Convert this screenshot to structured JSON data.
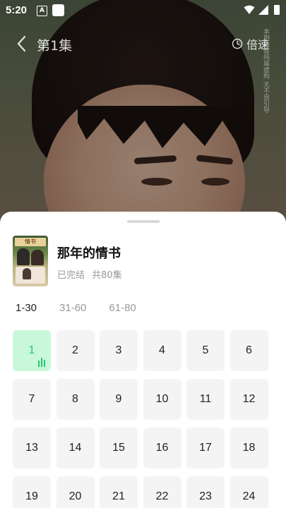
{
  "status_bar": {
    "time": "5:20",
    "notification_badge": "A"
  },
  "player": {
    "episode_title": "第1集",
    "speed_label": "倍速",
    "watermark_text": "本剧内容纯属虚构 无不良引导"
  },
  "drama": {
    "title": "那年的情书",
    "status": "已完结",
    "episode_count": "共80集",
    "cover_caption": "情书"
  },
  "range_tabs": [
    {
      "label": "1-30",
      "active": true
    },
    {
      "label": "31-60",
      "active": false
    },
    {
      "label": "61-80",
      "active": false
    }
  ],
  "episodes": [
    {
      "num": "1",
      "current": true
    },
    {
      "num": "2"
    },
    {
      "num": "3"
    },
    {
      "num": "4"
    },
    {
      "num": "5"
    },
    {
      "num": "6"
    },
    {
      "num": "7"
    },
    {
      "num": "8"
    },
    {
      "num": "9"
    },
    {
      "num": "10"
    },
    {
      "num": "11"
    },
    {
      "num": "12"
    },
    {
      "num": "13"
    },
    {
      "num": "14"
    },
    {
      "num": "15"
    },
    {
      "num": "16"
    },
    {
      "num": "17"
    },
    {
      "num": "18"
    },
    {
      "num": "19"
    },
    {
      "num": "20"
    },
    {
      "num": "21"
    },
    {
      "num": "22"
    },
    {
      "num": "23"
    },
    {
      "num": "24"
    }
  ],
  "colors": {
    "accent": "#28c76f",
    "current_bg": "#c8f7da",
    "cell_bg": "#f4f4f4"
  }
}
